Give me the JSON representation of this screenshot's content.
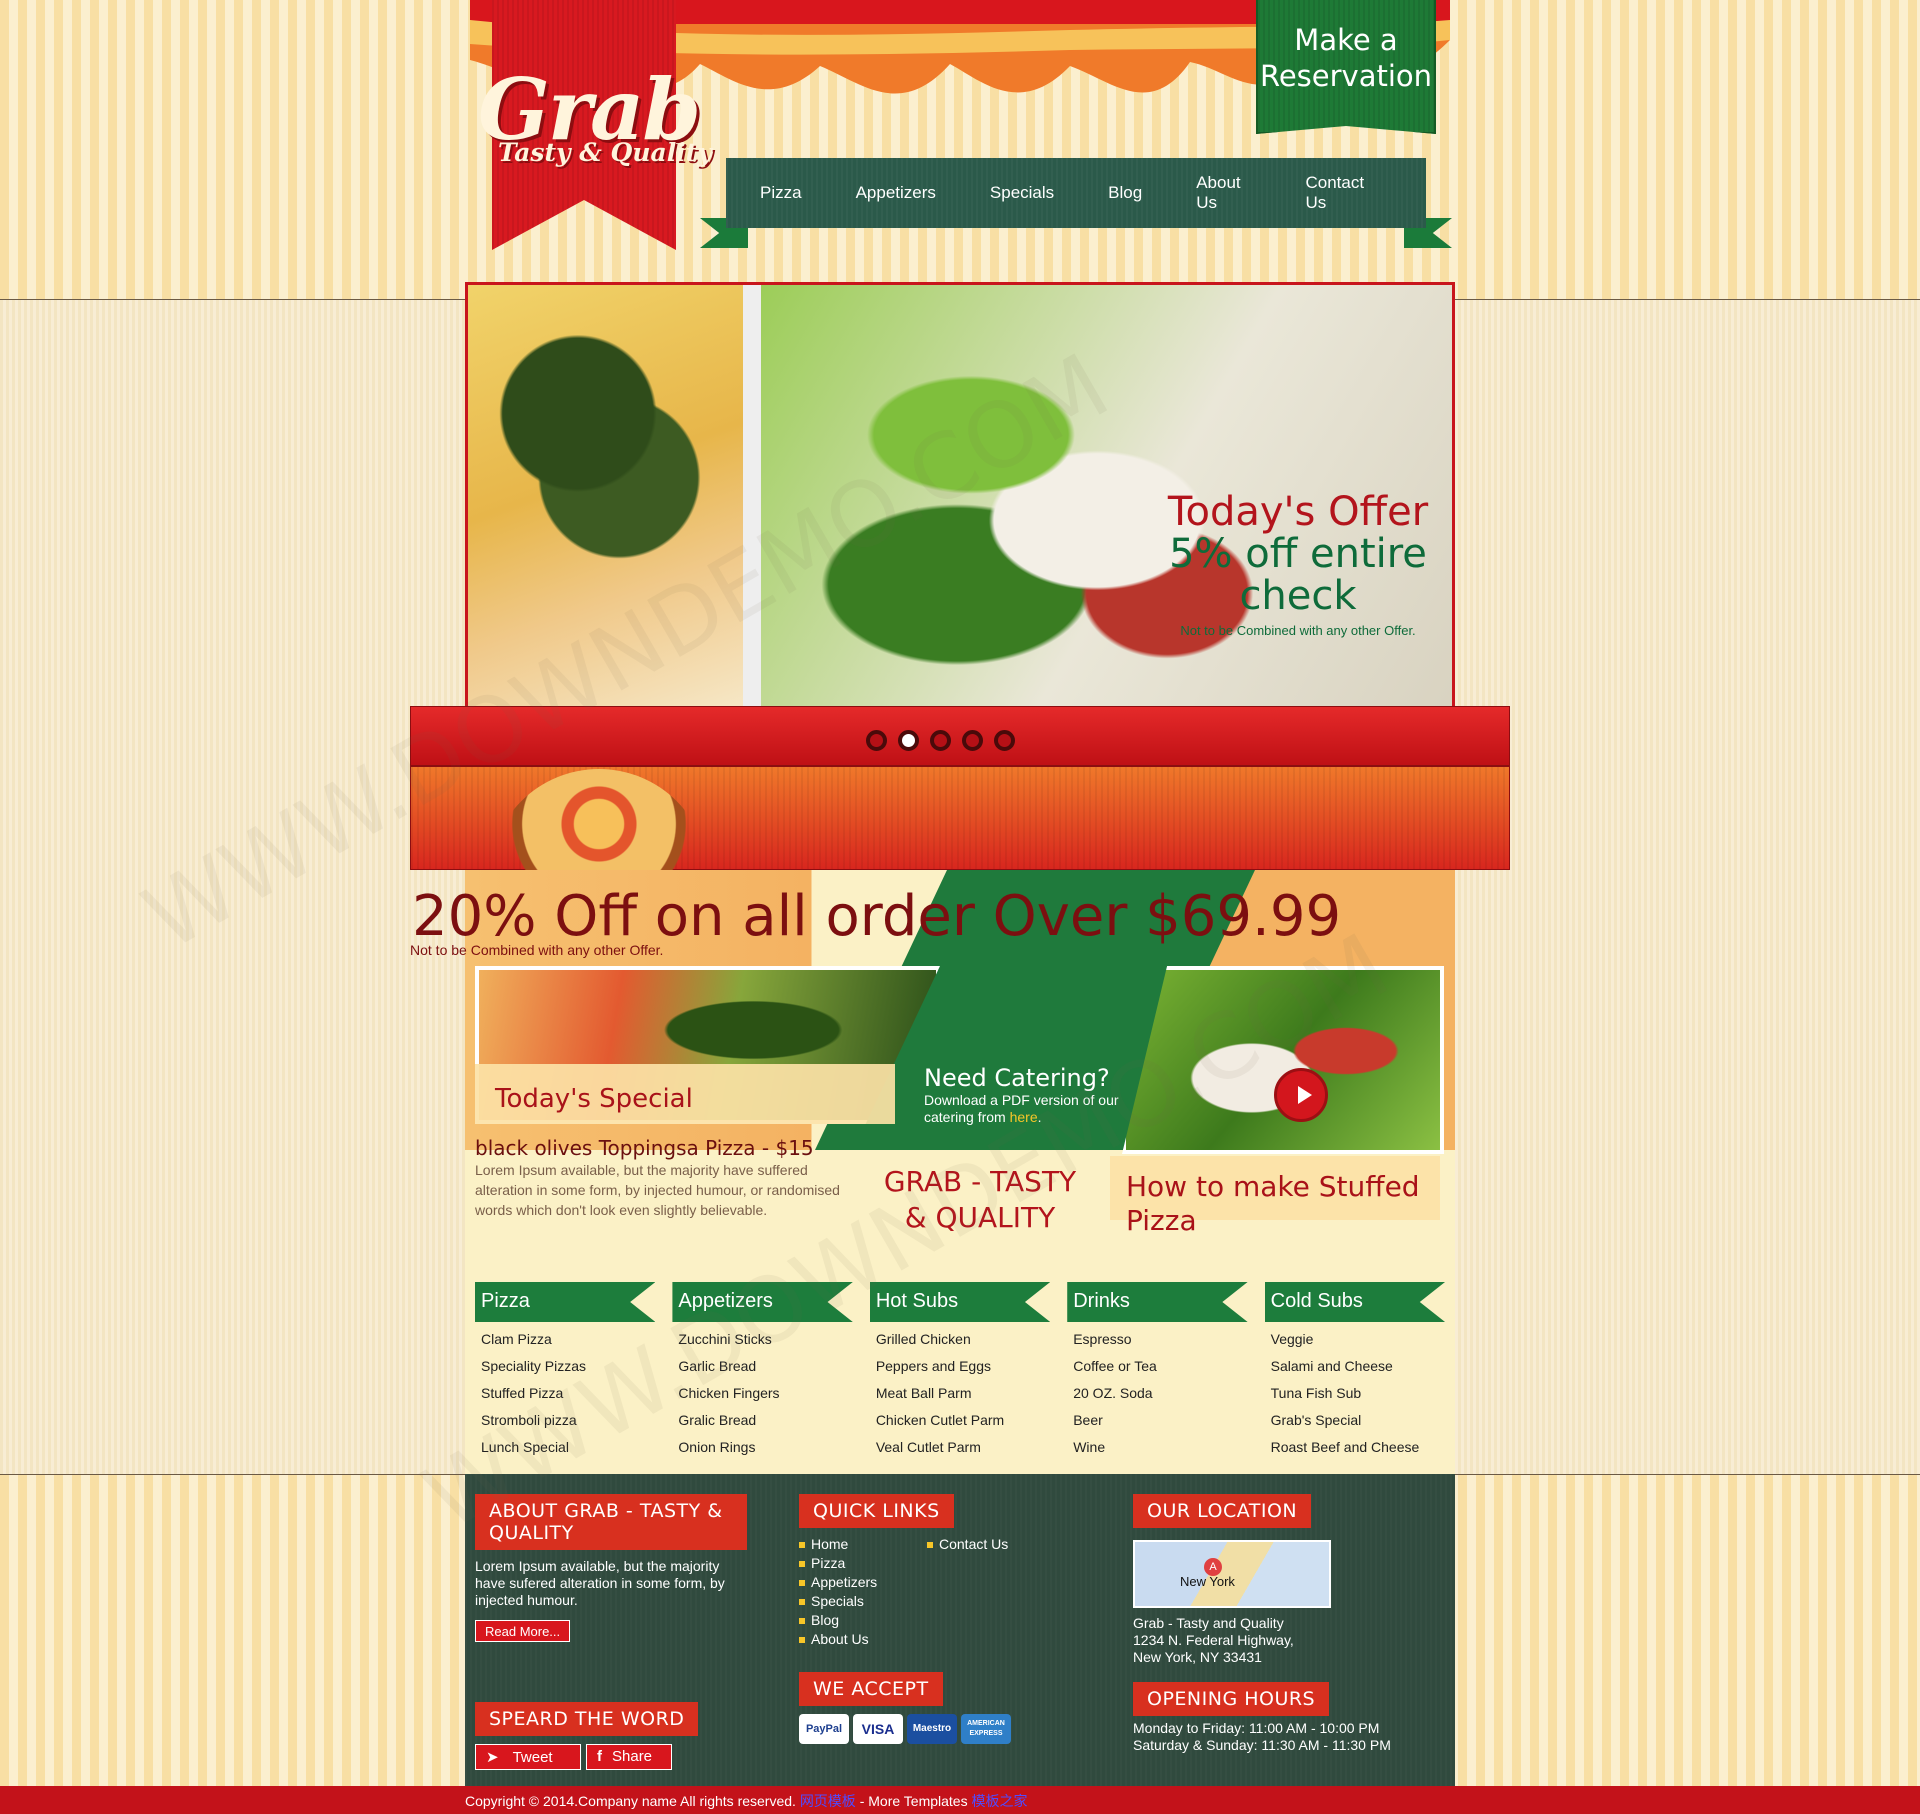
{
  "brand": {
    "logo": "Grab",
    "tagline": "Tasty & Quality"
  },
  "reservation": {
    "label": "Make a Reservation"
  },
  "nav": [
    "Pizza",
    "Appetizers",
    "Specials",
    "Blog",
    "About Us",
    "Contact Us"
  ],
  "slider": {
    "offer_title": "Today's Offer",
    "offer_body": "5% off entire check",
    "offer_note": "Not to be Combined with any other Offer.",
    "dots": 5,
    "active_dot": 2
  },
  "promo": {
    "headline": "20% Off on all order Over $69.99",
    "note": "Not to be Combined with any other Offer.",
    "today_special_label": "Today's Special",
    "special_title": "black olives Toppingsa Pizza - $15",
    "special_body": "Lorem Ipsum available, but the majority have suffered alteration in some form, by injected humour, or randomised words which don't look even slightly believable.",
    "catering_title": "Need Catering?",
    "catering_body": "Download a PDF version of our catering from",
    "catering_link": "here",
    "center_title": "GRAB - TASTY & QUALITY",
    "video_label": "How to make Stuffed Pizza"
  },
  "menu": [
    {
      "title": "Pizza",
      "items": [
        "Clam Pizza",
        "Speciality Pizzas",
        "Stuffed Pizza",
        "Stromboli pizza",
        "Lunch Special"
      ]
    },
    {
      "title": "Appetizers",
      "items": [
        "Zucchini Sticks",
        "Garlic Bread",
        "Chicken Fingers",
        "Gralic Bread",
        "Onion Rings"
      ]
    },
    {
      "title": "Hot Subs",
      "items": [
        "Grilled Chicken",
        "Peppers and Eggs",
        "Meat Ball Parm",
        "Chicken Cutlet Parm",
        "Veal Cutlet Parm"
      ]
    },
    {
      "title": "Drinks",
      "items": [
        "Espresso",
        "Coffee or Tea",
        "20 OZ. Soda",
        "Beer",
        "Wine"
      ]
    },
    {
      "title": "Cold Subs",
      "items": [
        "Veggie",
        "Salami and Cheese",
        "Tuna Fish Sub",
        "Grab's Special",
        "Roast Beef and Cheese"
      ]
    }
  ],
  "footer": {
    "about_title": "ABOUT GRAB - TASTY & QUALITY",
    "about_text": "Lorem Ipsum available, but the majority have sufered alteration in some form, by injected humour.",
    "read_more": "Read More...",
    "quick_links_title": "QUICK LINKS",
    "quick_links_col1": [
      "Home",
      "Pizza",
      "Appetizers",
      "Specials",
      "Blog",
      "About Us"
    ],
    "quick_links_col2": [
      "Contact Us"
    ],
    "location_title": "OUR LOCATION",
    "map_label": "New York",
    "map_pin": "A",
    "address": [
      "Grab - Tasty and Quality",
      "1234 N. Federal Highway,",
      "New York, NY 33431"
    ],
    "accept_title": "WE ACCEPT",
    "payment_cards": [
      "PayPal",
      "VISA",
      "Maestro",
      "AMERICAN EXPRESS"
    ],
    "hours_title": "OPENING HOURS",
    "hours": [
      "Monday to Friday: 11:00 AM - 10:00 PM",
      "Saturday & Sunday: 11:30 AM - 11:30 PM"
    ],
    "spread_title": "SPEARD THE WORD",
    "tweet": "Tweet",
    "share": "Share"
  },
  "copyright": {
    "text": "Copyright © 2014.Company name All rights reserved.",
    "link1": "网页模板",
    "sep": " - More Templates ",
    "link2": "模板之家"
  },
  "watermark": "WWW.DOWNDEMO.COM",
  "colors": {
    "brand_red": "#d8161d",
    "brand_green": "#1d7d3c",
    "footer_bg": "#304a3e",
    "accent_yellow": "#f7c628"
  }
}
